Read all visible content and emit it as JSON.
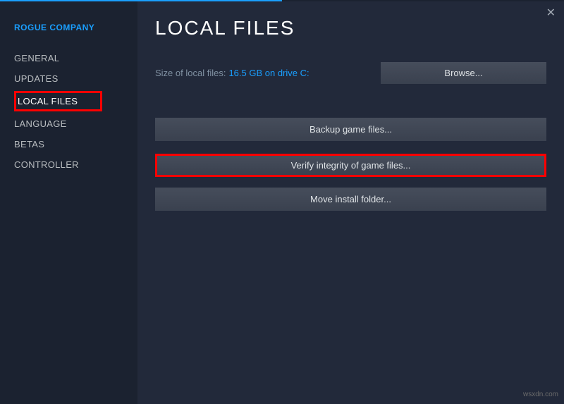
{
  "sidebar": {
    "title": "ROGUE COMPANY",
    "items": [
      {
        "label": "GENERAL"
      },
      {
        "label": "UPDATES"
      },
      {
        "label": "LOCAL FILES"
      },
      {
        "label": "LANGUAGE"
      },
      {
        "label": "BETAS"
      },
      {
        "label": "CONTROLLER"
      }
    ]
  },
  "main": {
    "title": "LOCAL FILES",
    "size_label": "Size of local files:",
    "size_value": "16.5 GB on drive C:",
    "browse_label": "Browse...",
    "backup_label": "Backup game files...",
    "verify_label": "Verify integrity of game files...",
    "move_label": "Move install folder..."
  },
  "watermark": "wsxdn.com"
}
